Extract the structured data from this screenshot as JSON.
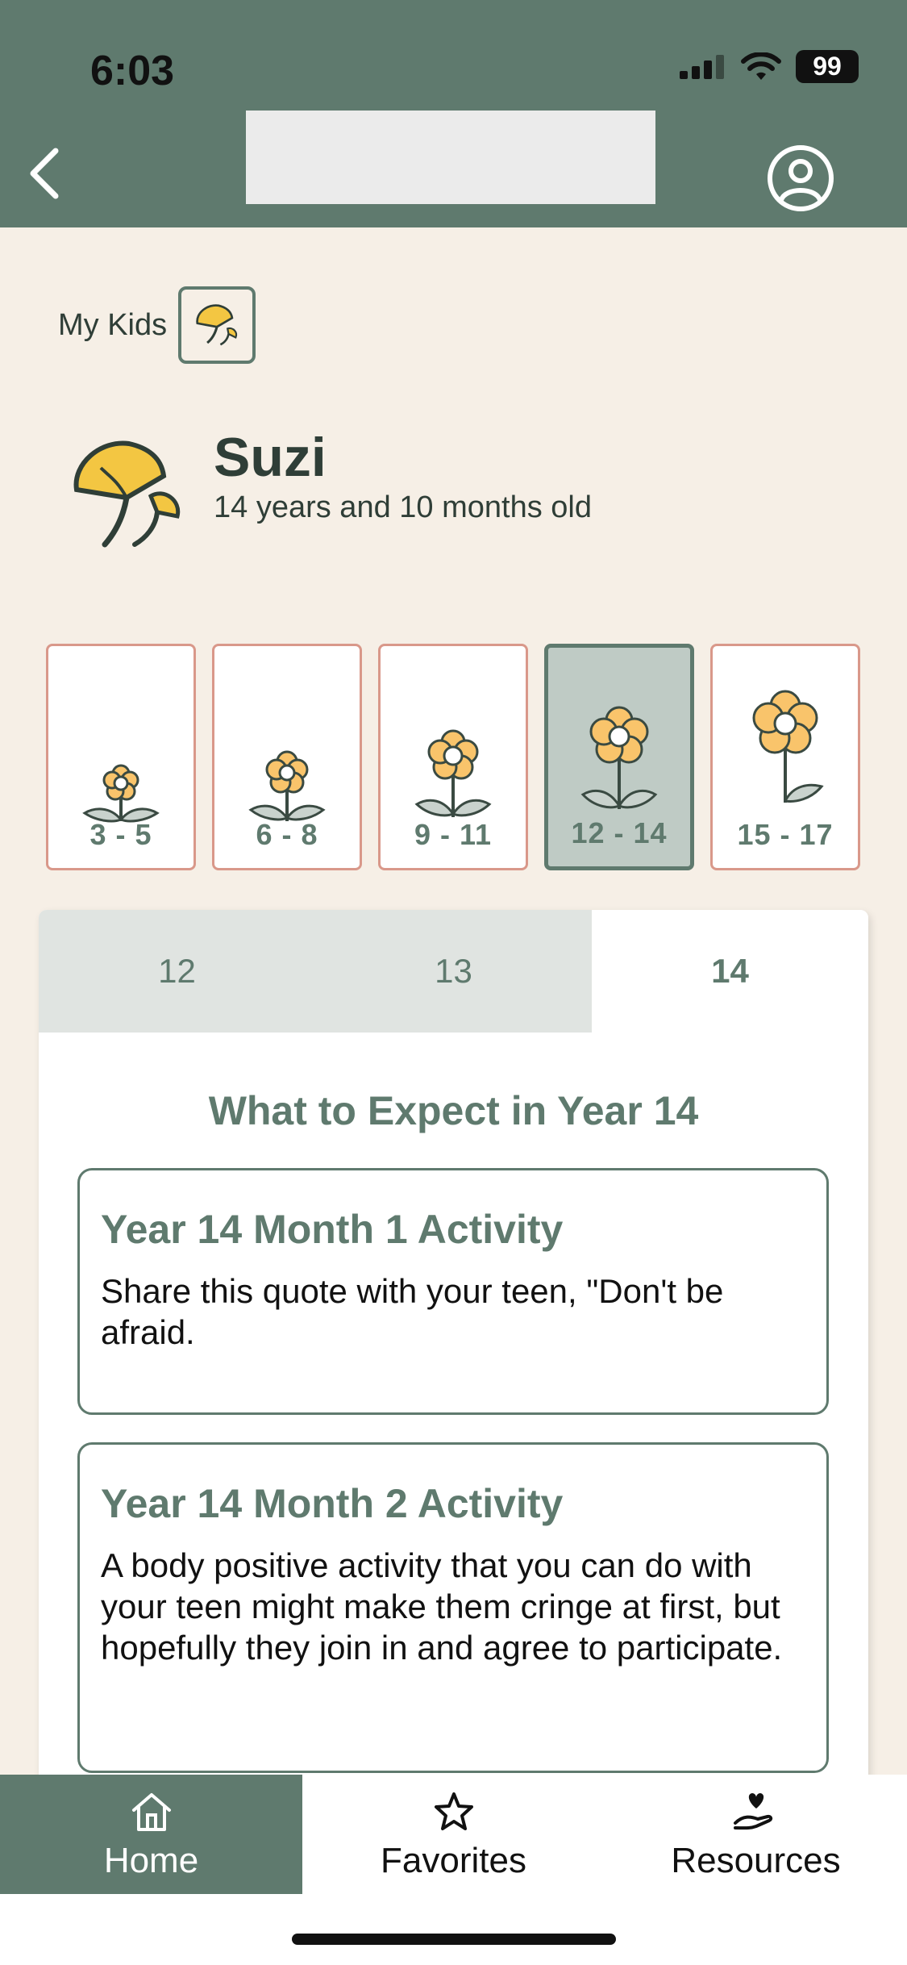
{
  "status": {
    "time": "6:03",
    "battery": "99"
  },
  "header": {
    "back_icon": "chevron-left-icon",
    "profile_icon": "user-circle-icon"
  },
  "my_kids": {
    "label": "My Kids"
  },
  "kid": {
    "name": "Suzi",
    "age": "14 years and 10 months old"
  },
  "age_ranges": [
    {
      "label": "3 - 5",
      "active": false
    },
    {
      "label": "6 - 8",
      "active": false
    },
    {
      "label": "9 - 11",
      "active": false
    },
    {
      "label": "12 - 14",
      "active": true
    },
    {
      "label": "15 - 17",
      "active": false
    }
  ],
  "year_tabs": [
    {
      "label": "12",
      "active": false
    },
    {
      "label": "13",
      "active": false
    },
    {
      "label": "14",
      "active": true
    }
  ],
  "section_title": "What to Expect in Year 14",
  "activities": [
    {
      "title": "Year 14 Month 1 Activity",
      "body": "Share this quote with your teen, \"Don't be afraid."
    },
    {
      "title": "Year 14 Month 2 Activity",
      "body": "A body positive activity that you can do with your teen might make them cringe at first, but hopefully they join in and agree to participate."
    }
  ],
  "tabbar": [
    {
      "label": "Home",
      "icon": "home-icon",
      "active": true
    },
    {
      "label": "Favorites",
      "icon": "star-icon",
      "active": false
    },
    {
      "label": "Resources",
      "icon": "hand-heart-icon",
      "active": false
    }
  ],
  "colors": {
    "header": "#5f7a6e",
    "background": "#f6efe6",
    "accent": "#5f7a6e",
    "card_border": "#d9988a",
    "flower": "#f9c46b"
  }
}
